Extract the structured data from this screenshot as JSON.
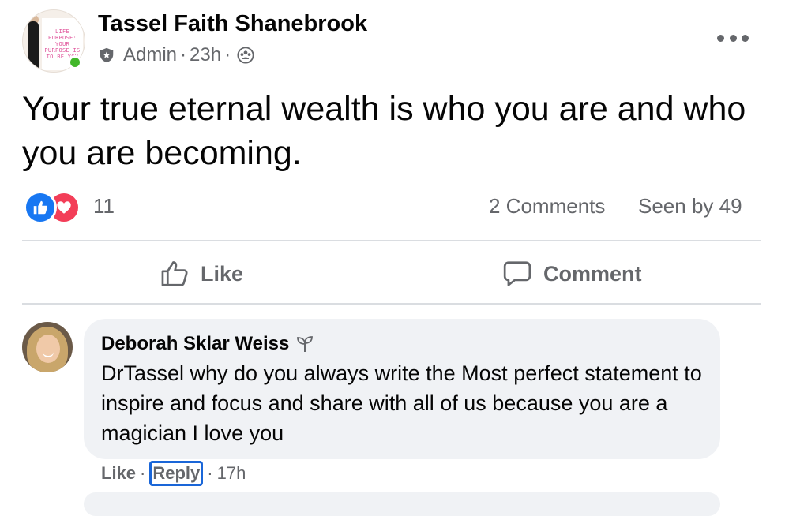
{
  "post": {
    "author": "Tassel Faith Shanebrook",
    "role": "Admin",
    "time": "23h",
    "meta_sep": "·",
    "avatar_text": [
      "LIFE",
      "PURPOSE:",
      "YOUR",
      "PURPOSE IS",
      "TO BE YOU"
    ],
    "text": "Your true eternal wealth is who you are and who you are becoming.",
    "reaction_count": "11",
    "comments_count": "2 Comments",
    "seen_by": "Seen by 49"
  },
  "actions": {
    "like": "Like",
    "comment": "Comment"
  },
  "comment": {
    "author": "Deborah Sklar Weiss",
    "text": "DrTassel why do you always write the Most perfect statement to inspire and focus and share with all of us because you are a magician I love you",
    "like": "Like",
    "reply": "Reply",
    "time": "17h",
    "sep": "·"
  },
  "icons": {
    "more": "more-horizontal-icon",
    "admin": "shield-icon",
    "audience": "group-icon",
    "like_reaction": "thumbs-up-icon",
    "love_reaction": "heart-icon",
    "like_action": "thumbs-up-outline-icon",
    "comment_action": "speech-bubble-icon",
    "new_member": "sprout-icon"
  },
  "colors": {
    "like_blue": "#1877f2",
    "love_red": "#f33e58",
    "online_green": "#42b72a",
    "secondary_text": "#65676b",
    "bubble_bg": "#f0f2f5",
    "focus_outline": "#1a66d8"
  }
}
